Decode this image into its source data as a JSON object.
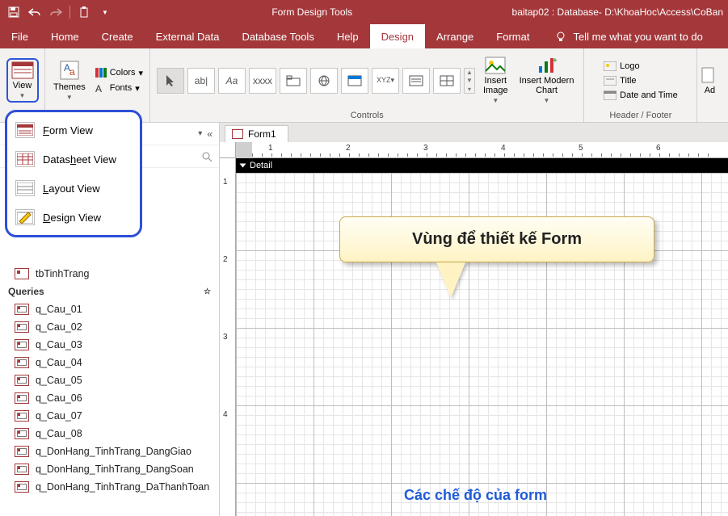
{
  "titlebar": {
    "context_title": "Form Design Tools",
    "window_title": "baitap02 : Database- D:\\KhoaHoc\\Access\\CoBan"
  },
  "tabs": {
    "file": "File",
    "home": "Home",
    "create": "Create",
    "external": "External Data",
    "dbtools": "Database Tools",
    "help": "Help",
    "design": "Design",
    "arrange": "Arrange",
    "format": "Format",
    "tellme": "Tell me what you want to do"
  },
  "ribbon": {
    "views": {
      "view": "View"
    },
    "themes": {
      "themes": "Themes",
      "colors": "Colors",
      "fonts": "Fonts"
    },
    "controls": {
      "label": "Controls",
      "insert_image": "Insert\nImage",
      "insert_chart": "Insert Modern\nChart"
    },
    "header_footer": {
      "label": "Header / Footer",
      "logo": "Logo",
      "title": "Title",
      "date": "Date and Time"
    },
    "add_label": "Ad"
  },
  "views_menu": {
    "form": "Form View",
    "datasheet": "Datasheet View",
    "layout": "Layout View",
    "design": "Design View"
  },
  "nav": {
    "collapse": "«",
    "group_expand": "☆",
    "queries_header": "Queries",
    "tables": [
      "tbTinhTrang"
    ],
    "queries": [
      "q_Cau_01",
      "q_Cau_02",
      "q_Cau_03",
      "q_Cau_04",
      "q_Cau_05",
      "q_Cau_06",
      "q_Cau_07",
      "q_Cau_08",
      "q_DonHang_TinhTrang_DangGiao",
      "q_DonHang_TinhTrang_DangSoan",
      "q_DonHang_TinhTrang_DaThanhToan"
    ]
  },
  "doc": {
    "tab": "Form1",
    "section": "Detail",
    "ruler_h": [
      "1",
      "2",
      "3",
      "4",
      "5",
      "6"
    ],
    "ruler_v": [
      "1",
      "2",
      "3",
      "4"
    ]
  },
  "callout": {
    "text": "Vùng để thiết kế Form",
    "caption": "Các chế độ của form"
  }
}
